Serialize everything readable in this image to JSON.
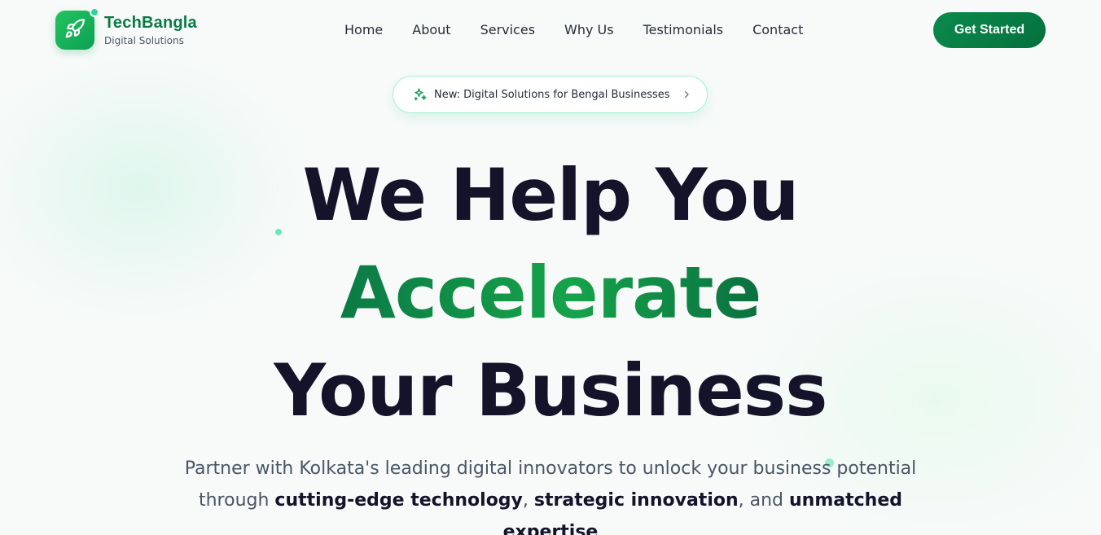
{
  "brand": {
    "name": "TechBangla",
    "tagline": "Digital Solutions",
    "accent": "#0a7a45"
  },
  "nav": {
    "items": [
      {
        "label": "Home"
      },
      {
        "label": "About"
      },
      {
        "label": "Services"
      },
      {
        "label": "Why Us"
      },
      {
        "label": "Testimonials"
      },
      {
        "label": "Contact"
      }
    ],
    "cta_label": "Get Started"
  },
  "announcement": {
    "text": "New: Digital Solutions for Bengal Businesses",
    "icon": "sparkles-icon"
  },
  "hero": {
    "line1": "We Help You",
    "line2": "Accelerate",
    "line3": "Your Business",
    "subtitle": {
      "part1": "Partner with Kolkata's leading digital innovators to unlock your business potential through ",
      "bold1": "cutting-edge technology",
      "part2": ", ",
      "bold2": "strategic innovation",
      "part3": ", and ",
      "bold3": "unmatched expertise"
    }
  },
  "colors": {
    "primary_green": "#0a8a4c",
    "headline_dark": "#14132a",
    "mint": "#6ee7b7"
  }
}
